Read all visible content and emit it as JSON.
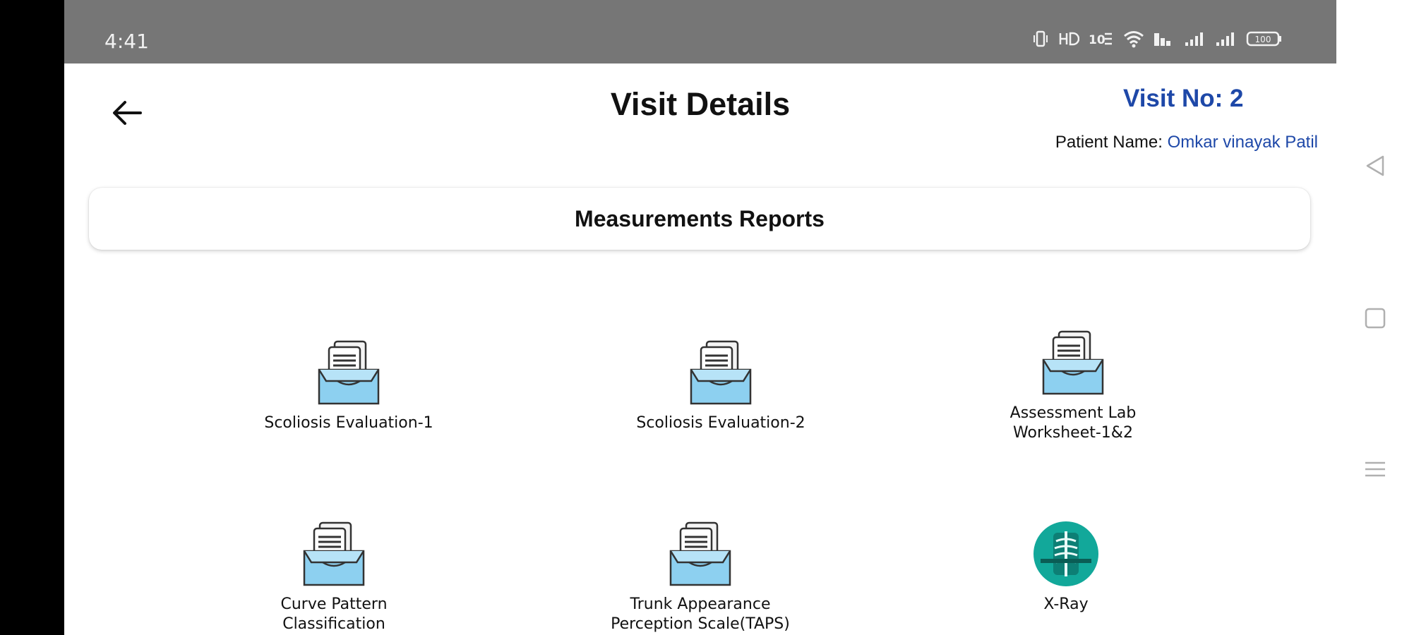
{
  "status_bar": {
    "time": "4:41",
    "battery": "100"
  },
  "header": {
    "title": "Visit Details",
    "visit_no": "Visit No: 2",
    "patient_label": "Patient Name:",
    "patient_name": "Omkar vinayak Patil"
  },
  "section": {
    "title": "Measurements Reports"
  },
  "tiles": [
    {
      "label": "Scoliosis Evaluation-1",
      "icon": "report-box-icon"
    },
    {
      "label": "Scoliosis Evaluation-2",
      "icon": "report-box-icon"
    },
    {
      "label": "Assessment Lab Worksheet-1&2",
      "icon": "report-box-icon"
    },
    {
      "label": "Curve Pattern Classification",
      "icon": "report-box-icon"
    },
    {
      "label": "Trunk Appearance Perception Scale(TAPS)",
      "icon": "report-box-icon"
    },
    {
      "label": "X-Ray",
      "icon": "xray-icon"
    }
  ],
  "colors": {
    "accent": "#1e48a8",
    "status_bar": "#767676"
  }
}
